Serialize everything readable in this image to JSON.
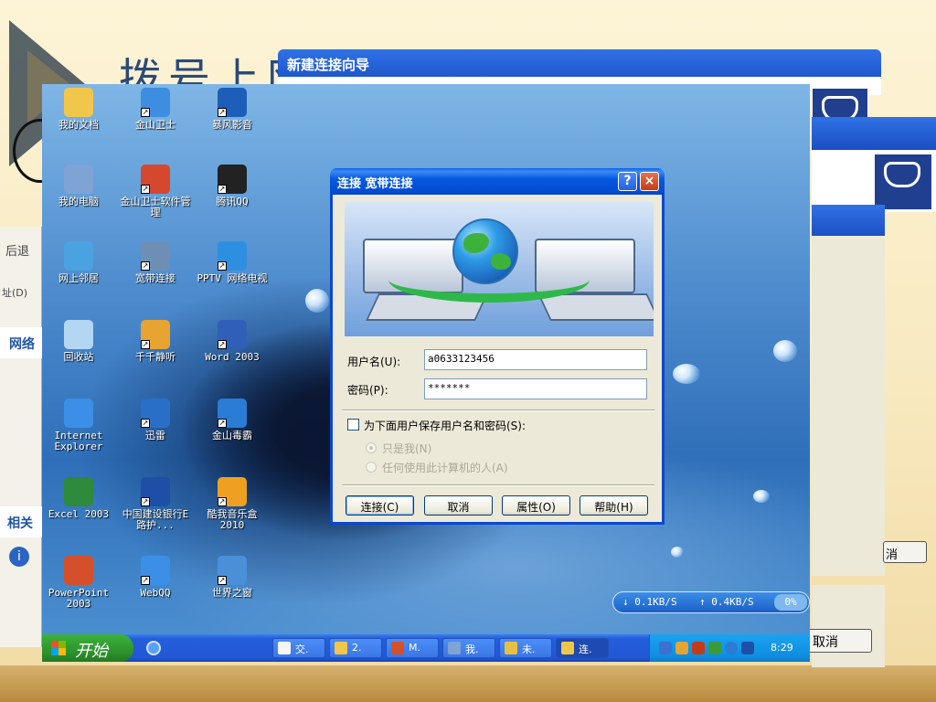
{
  "slide": {
    "title": "拨号上网"
  },
  "left_window": {
    "back_label": "后退",
    "address_label": "址(D)",
    "network_tasks": "网络",
    "related": "相关",
    "info_icon": "i"
  },
  "wizard": {
    "title": "新建连接向导",
    "cancel_label_a": "消",
    "cancel_label_b": "取消"
  },
  "desktop": {
    "icons": [
      {
        "label": "我的文档",
        "icon": "my-documents-icon",
        "color": "#f0c74a"
      },
      {
        "label": "金山卫士",
        "icon": "kingsoft-guard-icon",
        "color": "#3d8de0"
      },
      {
        "label": "暴风影音",
        "icon": "baofeng-player-icon",
        "color": "#1d5fb8"
      },
      {
        "label": "我的电脑",
        "icon": "my-computer-icon",
        "color": "#7ea3d4"
      },
      {
        "label": "金山卫士软件管理",
        "icon": "software-manager-icon",
        "color": "#d5472f"
      },
      {
        "label": "腾讯QQ",
        "icon": "qq-penguin-icon",
        "color": "#222222"
      },
      {
        "label": "网上邻居",
        "icon": "network-places-icon",
        "color": "#4aa2e0"
      },
      {
        "label": "宽带连接",
        "icon": "broadband-connection-icon",
        "color": "#6d8fb6"
      },
      {
        "label": "PPTV 网络电视",
        "icon": "pptv-icon",
        "color": "#2d8fe0"
      },
      {
        "label": "回收站",
        "icon": "recycle-bin-icon",
        "color": "#b3d6f2"
      },
      {
        "label": "千千静听",
        "icon": "ttplayer-icon",
        "color": "#e8a430"
      },
      {
        "label": "Word 2003",
        "icon": "word-icon",
        "color": "#2f5fb8"
      },
      {
        "label": "Internet Explorer",
        "icon": "internet-explorer-icon",
        "color": "#3b8fe6"
      },
      {
        "label": "迅雷",
        "icon": "thunder-icon",
        "color": "#2a6fc7"
      },
      {
        "label": "金山毒霸",
        "icon": "kingsoft-antivirus-icon",
        "color": "#2a7cd5"
      },
      {
        "label": "Excel 2003",
        "icon": "excel-icon",
        "color": "#2e8a3c"
      },
      {
        "label": "中国建设银行E路护...",
        "icon": "ccb-bank-icon",
        "color": "#1e4fa6"
      },
      {
        "label": "酷我音乐盒2010",
        "icon": "kuwo-music-icon",
        "color": "#f0a020"
      },
      {
        "label": "PowerPoint 2003",
        "icon": "powerpoint-icon",
        "color": "#d5502a"
      },
      {
        "label": "WebQQ",
        "icon": "webqq-icon",
        "color": "#3b8fe6"
      },
      {
        "label": "世界之窗",
        "icon": "theworld-browser-icon",
        "color": "#4a90d8"
      }
    ]
  },
  "netspeed": {
    "down": "0.1KB/S",
    "up": "0.4KB/S",
    "percent": "0%",
    "down_icon": "↓",
    "up_icon": "↑"
  },
  "taskbar": {
    "start_label": "开始",
    "buttons": [
      {
        "label": "交.",
        "icon": "doc-icon",
        "color": "#f5f5f5",
        "active": false
      },
      {
        "label": "2.",
        "icon": "folder-icon",
        "color": "#f0c74a",
        "active": false
      },
      {
        "label": "M.",
        "icon": "powerpoint-icon",
        "color": "#d5502a",
        "active": false
      },
      {
        "label": "我.",
        "icon": "person-icon",
        "color": "#7ea3d4",
        "active": false
      },
      {
        "label": "未.",
        "icon": "paint-icon",
        "color": "#e8c040",
        "active": false
      },
      {
        "label": "连.",
        "icon": "folder-icon",
        "color": "#f0c74a",
        "active": true
      }
    ],
    "clock": "8:29"
  },
  "dialog": {
    "title": "连接 宽带连接",
    "help": "?",
    "close": "×",
    "username_label": "用户名(U):",
    "username_value": "a0633123456",
    "password_label": "密码(P):",
    "password_value": "*******",
    "save_label": "为下面用户保存用户名和密码(S):",
    "save_checked": false,
    "radio_me": "只是我(N)",
    "radio_anyone": "任何使用此计算机的人(A)",
    "buttons": {
      "connect": "连接(C)",
      "cancel": "取消",
      "properties": "属性(O)",
      "help": "帮助(H)"
    }
  }
}
